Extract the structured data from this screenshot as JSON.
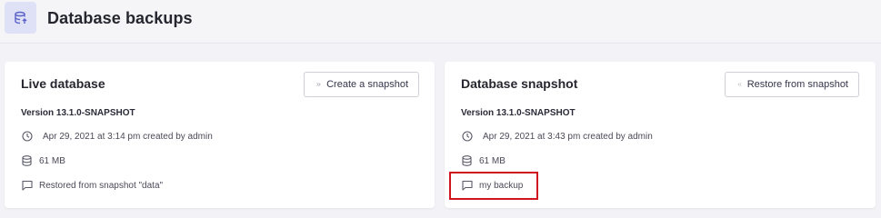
{
  "header": {
    "title": "Database backups",
    "icon": "database-restore-icon",
    "icon_color": "#5a63c9"
  },
  "live": {
    "title": "Live database",
    "button_label": "Create a snapshot",
    "button_icon": "double-chevron-right-icon",
    "version": "Version 13.1.0-SNAPSHOT",
    "created": "Apr 29, 2021 at 3:14 pm created by admin",
    "size": "61 MB",
    "comment": "Restored from snapshot \"data\""
  },
  "snapshot": {
    "title": "Database snapshot",
    "button_label": "Restore from snapshot",
    "button_icon": "double-chevron-left-icon",
    "version": "Version 13.1.0-SNAPSHOT",
    "created": "Apr 29, 2021 at 3:43 pm created by admin",
    "size": "61 MB",
    "comment": "my backup"
  },
  "colors": {
    "accent": "#5a63c9",
    "highlight": "#d0161c"
  }
}
